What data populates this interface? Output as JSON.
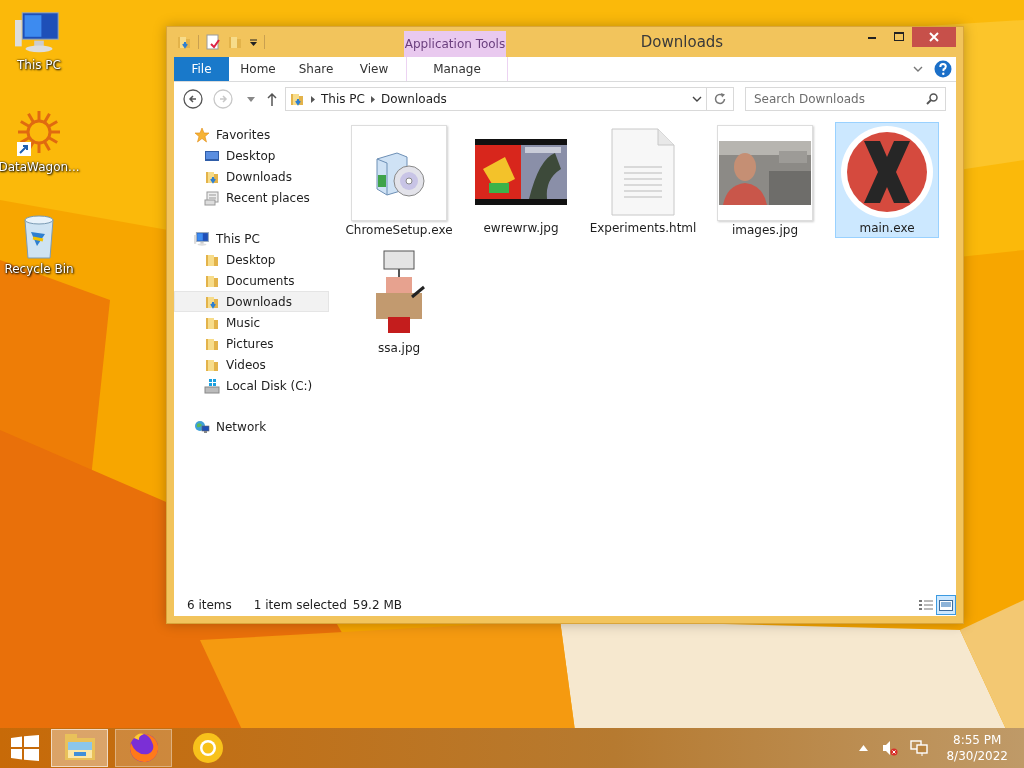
{
  "desktop_icons": [
    {
      "label": "This PC"
    },
    {
      "label": "DataWagon..."
    },
    {
      "label": "Recycle Bin"
    }
  ],
  "window": {
    "title": "Downloads",
    "ribbon_group": "Application Tools"
  },
  "ribbon_tabs": [
    {
      "label": "File",
      "kind": "file"
    },
    {
      "label": "Home",
      "kind": "tab"
    },
    {
      "label": "Share",
      "kind": "tab"
    },
    {
      "label": "View",
      "kind": "tab"
    },
    {
      "label": "Manage",
      "kind": "contextual"
    }
  ],
  "nav_buttons": [
    {
      "kind": "back",
      "disabled": false
    },
    {
      "kind": "forward",
      "disabled": true
    }
  ],
  "address": {
    "crumbs": [
      "This PC",
      "Downloads"
    ]
  },
  "search": {
    "placeholder": "Search Downloads"
  },
  "nav": [
    {
      "label": "Favorites",
      "selected": false,
      "children": [
        {
          "label": "Desktop",
          "selected": false
        },
        {
          "label": "Downloads",
          "selected": false
        },
        {
          "label": "Recent places",
          "selected": false
        }
      ]
    },
    {
      "label": "This PC",
      "selected": false,
      "children": [
        {
          "label": "Desktop",
          "selected": false
        },
        {
          "label": "Documents",
          "selected": false
        },
        {
          "label": "Downloads",
          "selected": true
        },
        {
          "label": "Music",
          "selected": false
        },
        {
          "label": "Pictures",
          "selected": false
        },
        {
          "label": "Videos",
          "selected": false
        },
        {
          "label": "Local Disk (C:)",
          "selected": false
        }
      ]
    },
    {
      "label": "Network",
      "selected": false
    }
  ],
  "files": [
    {
      "name": "ChromeSetup.exe",
      "kind": "installer",
      "selected": false
    },
    {
      "name": "ewrewrw.jpg",
      "kind": "picture",
      "selected": false
    },
    {
      "name": "Experiments.html",
      "kind": "document",
      "selected": false
    },
    {
      "name": "images.jpg",
      "kind": "picture",
      "selected": false
    },
    {
      "name": "main.exe",
      "kind": "app",
      "selected": true
    },
    {
      "name": "ssa.jpg",
      "kind": "picture",
      "selected": false
    }
  ],
  "status_bar": {
    "count": "6 items",
    "selection": "1 item selected",
    "size": "59.2 MB",
    "views": [
      {
        "kind": "details",
        "selected": false
      },
      {
        "kind": "thumbnails",
        "selected": true
      }
    ]
  },
  "taskbar": {
    "apps": [
      {
        "kind": "explorer",
        "running": true,
        "selected": true
      },
      {
        "kind": "firefox",
        "running": true,
        "selected": false
      },
      {
        "kind": "chrome",
        "running": false,
        "selected": false
      }
    ],
    "volume_muted": true,
    "clock": {
      "time": "8:55 PM",
      "date": "8/30/2022"
    }
  }
}
